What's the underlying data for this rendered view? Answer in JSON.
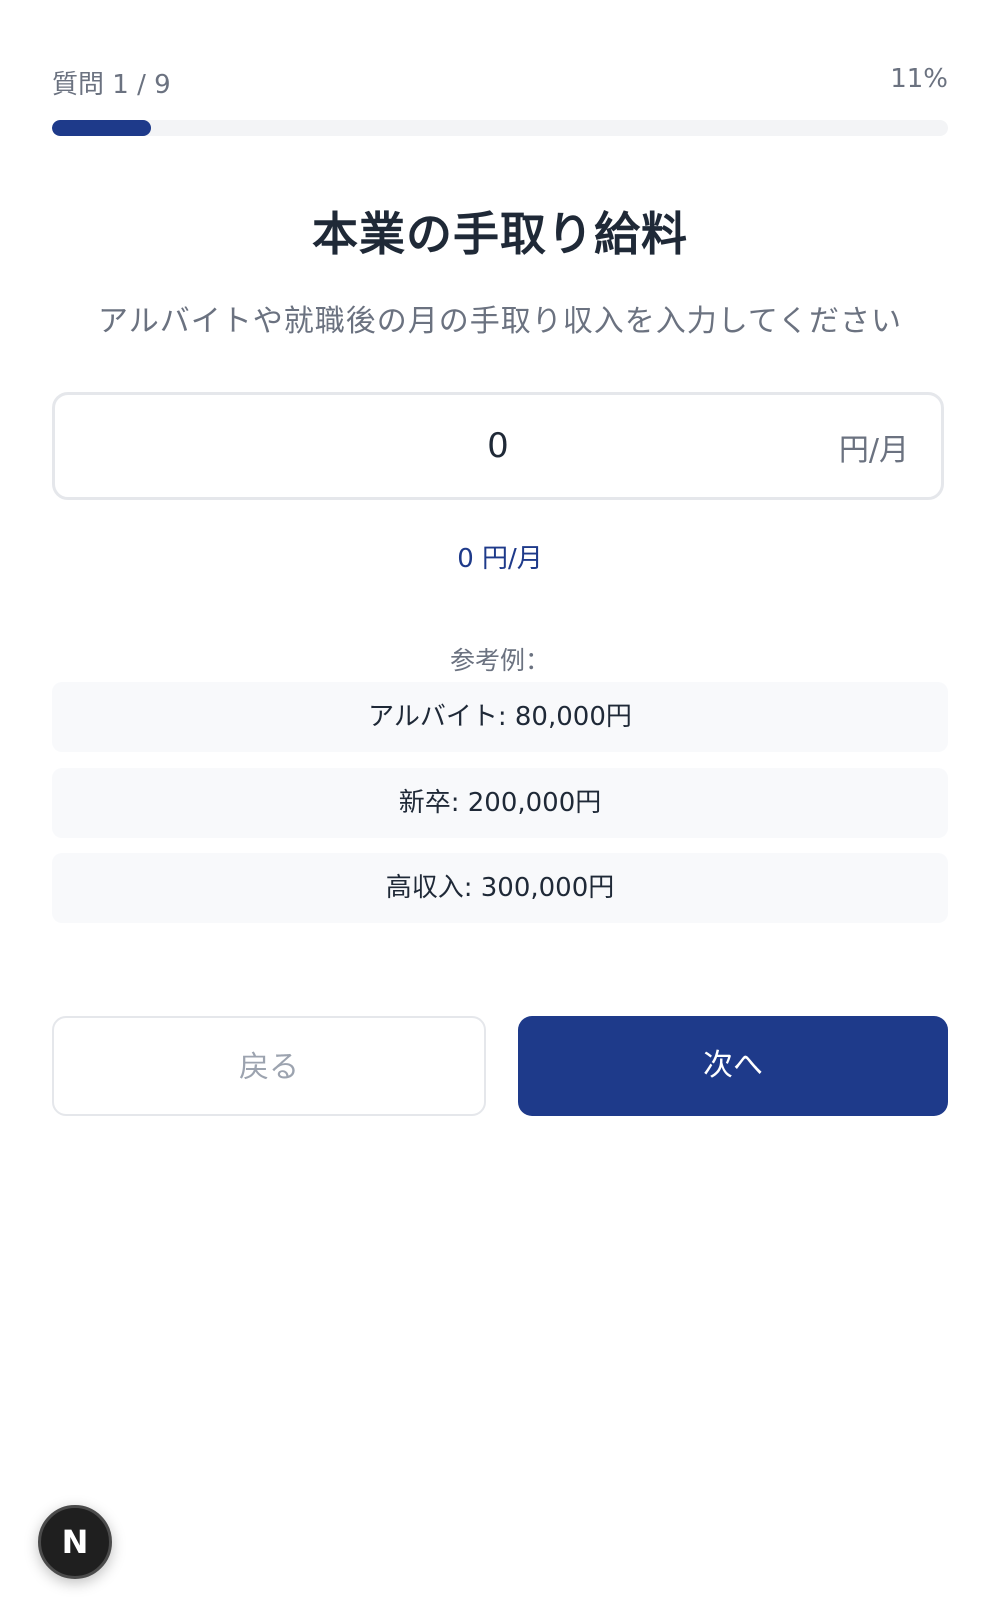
{
  "progress": {
    "label": "質問 1 / 9",
    "percent_text": "11%",
    "fraction": 0.11
  },
  "question": {
    "title": "本業の手取り給料",
    "subtitle": "アルバイトや就職後の月の手取り収入を入力してください"
  },
  "amount_input": {
    "value": "0",
    "unit": "円/月"
  },
  "amount_preview": "0 円/月",
  "examples": {
    "label": "参考例：",
    "items": [
      {
        "label": "アルバイト: 80,000円"
      },
      {
        "label": "新卒: 200,000円"
      },
      {
        "label": "高収入: 300,000円"
      }
    ]
  },
  "navigation": {
    "back_label": "戻る",
    "next_label": "次へ"
  },
  "dev_badge": {
    "letter": "N"
  },
  "colors": {
    "accent": "#1e3a8a",
    "muted_text": "#6b7280",
    "body_text": "#1f2937",
    "example_bg": "#f8f9fb"
  }
}
